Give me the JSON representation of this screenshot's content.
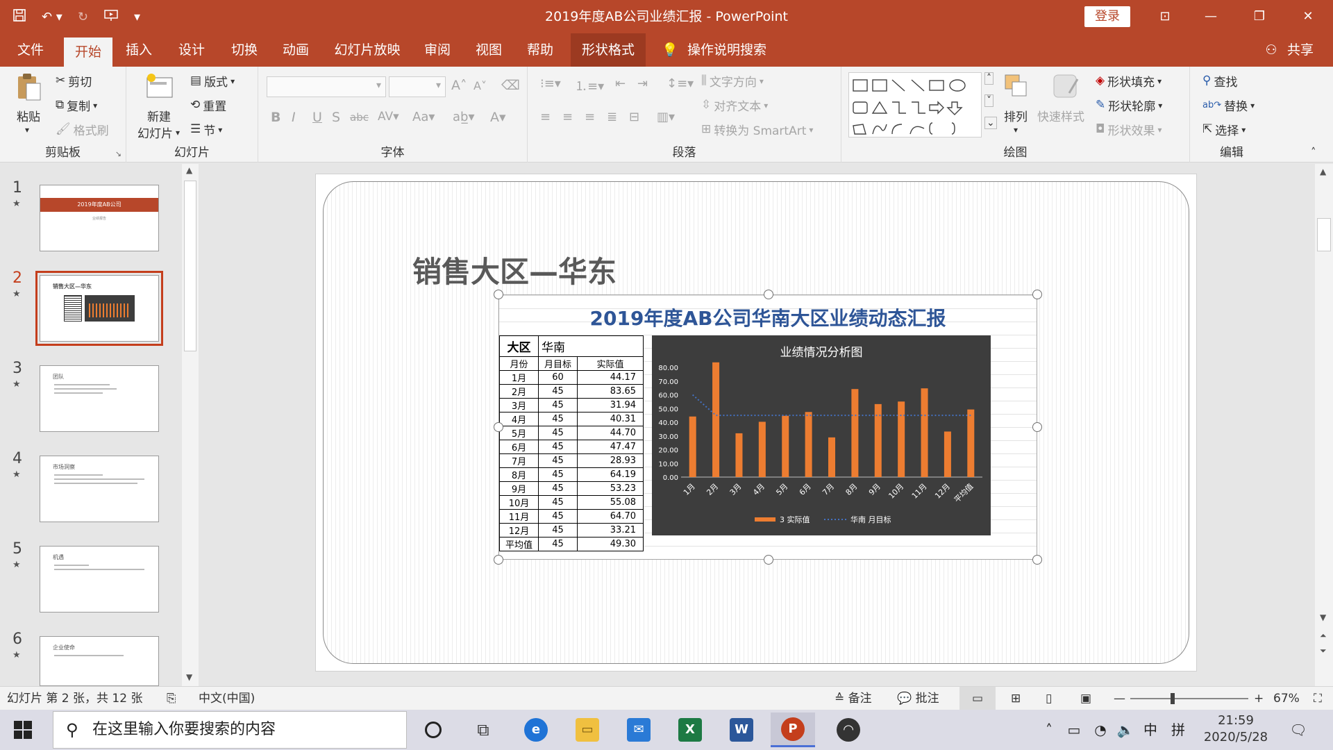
{
  "window": {
    "title": "2019年度AB公司业绩汇报 - PowerPoint",
    "login_label": "登录",
    "share_label": "共享"
  },
  "tabs": [
    "文件",
    "开始",
    "插入",
    "设计",
    "切换",
    "动画",
    "幻灯片放映",
    "审阅",
    "视图",
    "帮助",
    "形状格式"
  ],
  "tell_me": "操作说明搜索",
  "ribbon": {
    "clipboard": {
      "label": "剪贴板",
      "paste": "粘贴",
      "cut": "剪切",
      "copy": "复制",
      "format_painter": "格式刷"
    },
    "slides": {
      "label": "幻灯片",
      "new_slide_1": "新建",
      "new_slide_2": "幻灯片",
      "layout": "版式",
      "reset": "重置",
      "section": "节"
    },
    "font": {
      "label": "字体"
    },
    "paragraph": {
      "label": "段落",
      "text_direction": "文字方向",
      "align_text": "对齐文本",
      "convert_smartart": "转换为 SmartArt"
    },
    "drawing": {
      "label": "绘图",
      "arrange": "排列",
      "quick_styles": "快速样式",
      "shape_fill": "形状填充",
      "shape_outline": "形状轮廓",
      "shape_effects": "形状效果"
    },
    "editing": {
      "label": "编辑",
      "find": "查找",
      "replace": "替换",
      "select": "选择"
    }
  },
  "thumbnails": [
    {
      "num": "1",
      "title": "2019年度AB公司",
      "sub": "业绩报告"
    },
    {
      "num": "2",
      "title": "销售大区—华东"
    },
    {
      "num": "3",
      "title": "团队"
    },
    {
      "num": "4",
      "title": "市场洞察"
    },
    {
      "num": "5",
      "title": "机遇"
    },
    {
      "num": "6",
      "title": "企业使命"
    }
  ],
  "slide": {
    "heading": "销售大区—华东",
    "object_title": "2019年度AB公司华南大区业绩动态汇报",
    "table": {
      "region_label": "大区",
      "region_value": "华南",
      "headers": [
        "月份",
        "月目标",
        "实际值"
      ],
      "rows": [
        [
          "1月",
          "60",
          "44.17"
        ],
        [
          "2月",
          "45",
          "83.65"
        ],
        [
          "3月",
          "45",
          "31.94"
        ],
        [
          "4月",
          "45",
          "40.31"
        ],
        [
          "5月",
          "45",
          "44.70"
        ],
        [
          "6月",
          "45",
          "47.47"
        ],
        [
          "7月",
          "45",
          "28.93"
        ],
        [
          "8月",
          "45",
          "64.19"
        ],
        [
          "9月",
          "45",
          "53.23"
        ],
        [
          "10月",
          "45",
          "55.08"
        ],
        [
          "11月",
          "45",
          "64.70"
        ],
        [
          "12月",
          "45",
          "33.21"
        ],
        [
          "平均值",
          "45",
          "49.30"
        ]
      ]
    }
  },
  "chart_data": {
    "type": "bar",
    "title": "业绩情况分析图",
    "categories": [
      "1月",
      "2月",
      "3月",
      "4月",
      "5月",
      "6月",
      "7月",
      "8月",
      "9月",
      "10月",
      "11月",
      "12月",
      "平均值"
    ],
    "series": [
      {
        "name": "3 实际值",
        "type": "bar",
        "color": "#ed7d31",
        "values": [
          44.17,
          83.65,
          31.94,
          40.31,
          44.7,
          47.47,
          28.93,
          64.19,
          53.23,
          55.08,
          64.7,
          33.21,
          49.3
        ]
      },
      {
        "name": "华南 月目标",
        "type": "line",
        "style": "dotted",
        "color": "#4472c4",
        "values": [
          60,
          45,
          45,
          45,
          45,
          45,
          45,
          45,
          45,
          45,
          45,
          45,
          45
        ]
      }
    ],
    "y_ticks": [
      "0.00",
      "10.00",
      "20.00",
      "30.00",
      "40.00",
      "50.00",
      "60.00",
      "70.00",
      "80.00"
    ],
    "ylim": [
      0,
      80
    ],
    "background": "#3d3d3d",
    "legend": "bottom",
    "grid": false
  },
  "status": {
    "slide_info": "幻灯片 第 2 张，共 12 张",
    "language": "中文(中国)",
    "notes": "备注",
    "comments": "批注",
    "zoom": "67%"
  },
  "taskbar": {
    "search_placeholder": "在这里输入你要搜索的内容",
    "time": "21:59",
    "date": "2020/5/28",
    "ime_lang": "中",
    "ime_mode": "拼"
  },
  "colors": {
    "accent": "#b7472a",
    "chart_bar": "#ed7d31",
    "chart_line": "#4472c4",
    "title_blue": "#2e5597"
  }
}
